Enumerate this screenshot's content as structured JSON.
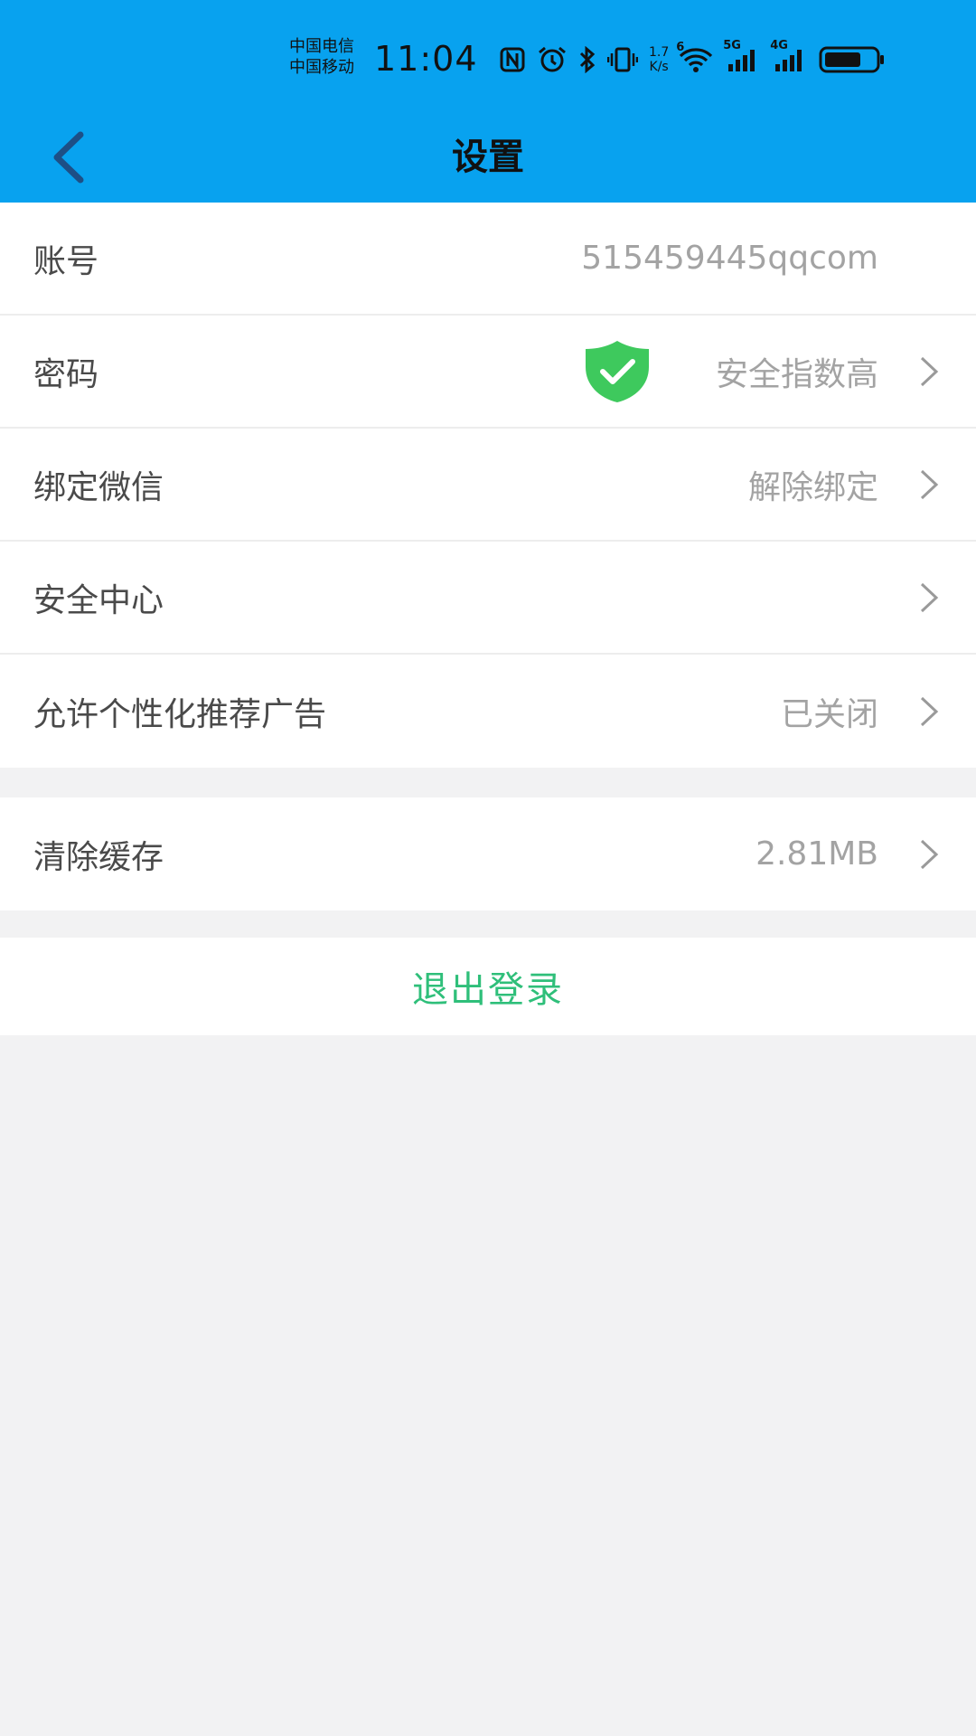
{
  "status_bar": {
    "carrier_1": "中国电信",
    "carrier_2": "中国移动",
    "time": "11:04",
    "net_speed_value": "1.7",
    "net_speed_unit": "K/s",
    "wifi_badge": "6",
    "sim1_type": "5G",
    "sim2_type": "4G",
    "icons": [
      "nfc-icon",
      "alarm-icon",
      "bluetooth-icon",
      "vibrate-icon",
      "wifi-icon",
      "signal-icon",
      "battery-icon"
    ],
    "battery_level": 0.72
  },
  "nav": {
    "title": "设置",
    "back_icon": "chevron-left-icon"
  },
  "settings_group_1": [
    {
      "label": "账号",
      "value": "515459445qqcom",
      "has_arrow": false
    },
    {
      "label": "密码",
      "value": "安全指数高",
      "has_arrow": true,
      "badge_icon": "shield-check-icon"
    },
    {
      "label": "绑定微信",
      "value": "解除绑定",
      "has_arrow": true
    },
    {
      "label": "安全中心",
      "value": "",
      "has_arrow": true
    },
    {
      "label": "允许个性化推荐广告",
      "value": "已关闭",
      "has_arrow": true
    }
  ],
  "settings_group_2": [
    {
      "label": "清除缓存",
      "value": "2.81MB",
      "has_arrow": true
    }
  ],
  "logout": {
    "label": "退出登录"
  },
  "colors": {
    "header_bg": "#08a2ef",
    "logout_text": "#2fbf7a",
    "shield": "#3ec95d",
    "page_bg": "#f2f2f3"
  }
}
